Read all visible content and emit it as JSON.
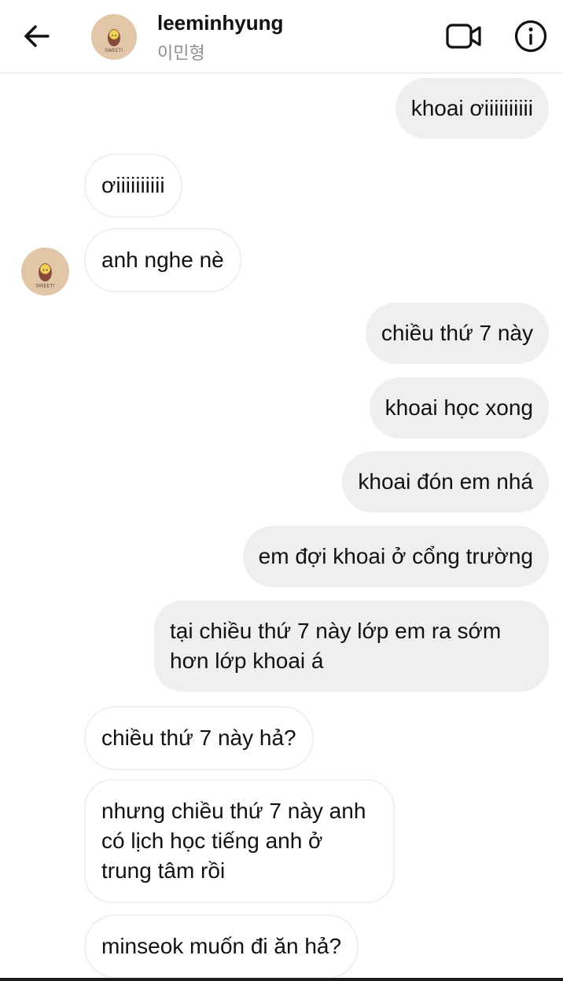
{
  "header": {
    "username": "leeminhyung",
    "subtitle": "이민형",
    "avatar_text": "SWEET!"
  },
  "icons": {
    "back": "arrow-left-icon",
    "video": "video-camera-icon",
    "info": "info-circle-icon"
  },
  "colors": {
    "outgoing_bubble": "#efefef",
    "incoming_border": "#efefef",
    "avatar_bg": "#e2c6a8"
  },
  "messages": [
    {
      "direction": "out",
      "text": "khoai ơiiiiiiiiii"
    },
    {
      "direction": "in",
      "text": "ơiiiiiiiiii"
    },
    {
      "direction": "in",
      "text": "anh nghe nè"
    },
    {
      "direction": "out",
      "text": "chiều thứ 7 này"
    },
    {
      "direction": "out",
      "text": "khoai học xong"
    },
    {
      "direction": "out",
      "text": "khoai đón em nhá"
    },
    {
      "direction": "out",
      "text": "em đợi khoai ở cổng trường"
    },
    {
      "direction": "out",
      "text": "tại chiều thứ 7 này lớp em ra sớm hơn lớp khoai á"
    },
    {
      "direction": "in",
      "text": "chiều thứ 7 này hả?"
    },
    {
      "direction": "in",
      "text": "nhưng chiều thứ 7 này anh có lịch học tiếng anh ở trung tâm rồi"
    },
    {
      "direction": "in",
      "text": "minseok muốn đi ăn hả?"
    }
  ]
}
